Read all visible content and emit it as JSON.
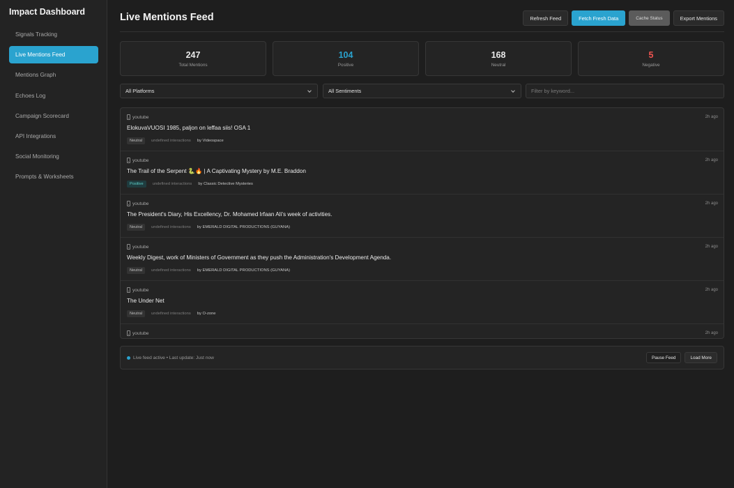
{
  "app": {
    "title": "Impact Dashboard"
  },
  "sidebar": {
    "items": [
      {
        "label": "Signals Tracking"
      },
      {
        "label": "Live Mentions Feed",
        "active": true
      },
      {
        "label": "Mentions Graph"
      },
      {
        "label": "Echoes Log"
      },
      {
        "label": "Campaign Scorecard"
      },
      {
        "label": "API Integrations"
      },
      {
        "label": "Social Monitoring"
      },
      {
        "label": "Prompts & Worksheets"
      }
    ]
  },
  "header": {
    "title": "Live Mentions Feed",
    "buttons": {
      "refresh": "Refresh Feed",
      "fetch": "Fetch Fresh Data",
      "cache": "Cache Status",
      "export": "Export Mentions"
    }
  },
  "stats": [
    {
      "value": "247",
      "label": "Total Mentions",
      "color": "#eaeaea"
    },
    {
      "value": "104",
      "label": "Positive",
      "color": "#2aa3cf"
    },
    {
      "value": "168",
      "label": "Neutral",
      "color": "#eaeaea"
    },
    {
      "value": "5",
      "label": "Negative",
      "color": "#ef5350"
    }
  ],
  "filters": {
    "platform": "All Platforms",
    "sentiment": "All Sentiments",
    "keyword_placeholder": "Filter by keyword..."
  },
  "feed": [
    {
      "platform": "youtube",
      "time": "2h ago",
      "title": "ElokuvaVUOSI 1985, paljon on leffaa siis! OSA 1",
      "sentiment": "Neutral",
      "interactions": "undefined interactions",
      "author": "by Videospace"
    },
    {
      "platform": "youtube",
      "time": "2h ago",
      "title": "The Trail of the Serpent 🐍🔥 | A Captivating Mystery by M.E. Braddon",
      "sentiment": "Positive",
      "interactions": "undefined interactions",
      "author": "by Classic Detective Mysteries"
    },
    {
      "platform": "youtube",
      "time": "2h ago",
      "title": "The President's Diary, His Excellency, Dr. Mohamed Irfaan Ali's week of activities.",
      "sentiment": "Neutral",
      "interactions": "undefined interactions",
      "author": "by EMERALD DIGITAL PRODUCTIONS (GUYANA)"
    },
    {
      "platform": "youtube",
      "time": "2h ago",
      "title": "Weekly Digest, work of Ministers of Government as they push the Administration's Development Agenda.",
      "sentiment": "Neutral",
      "interactions": "undefined interactions",
      "author": "by EMERALD DIGITAL PRODUCTIONS (GUYANA)"
    },
    {
      "platform": "youtube",
      "time": "2h ago",
      "title": "The Under Net",
      "sentiment": "Neutral",
      "interactions": "undefined interactions",
      "author": "by O-zone"
    },
    {
      "platform": "youtube",
      "time": "2h ago",
      "title": "",
      "sentiment": "",
      "interactions": "",
      "author": ""
    }
  ],
  "footer": {
    "status": "Live feed active • Last update: Just now",
    "pause": "Pause Feed",
    "load_more": "Load More"
  },
  "icons": {
    "platform": "phone-icon",
    "dropdown": "chevron-down-icon",
    "live": "live-dot-icon"
  },
  "colors": {
    "accent": "#2aa3cf",
    "negative": "#ef5350",
    "background": "#1e1e1e"
  }
}
